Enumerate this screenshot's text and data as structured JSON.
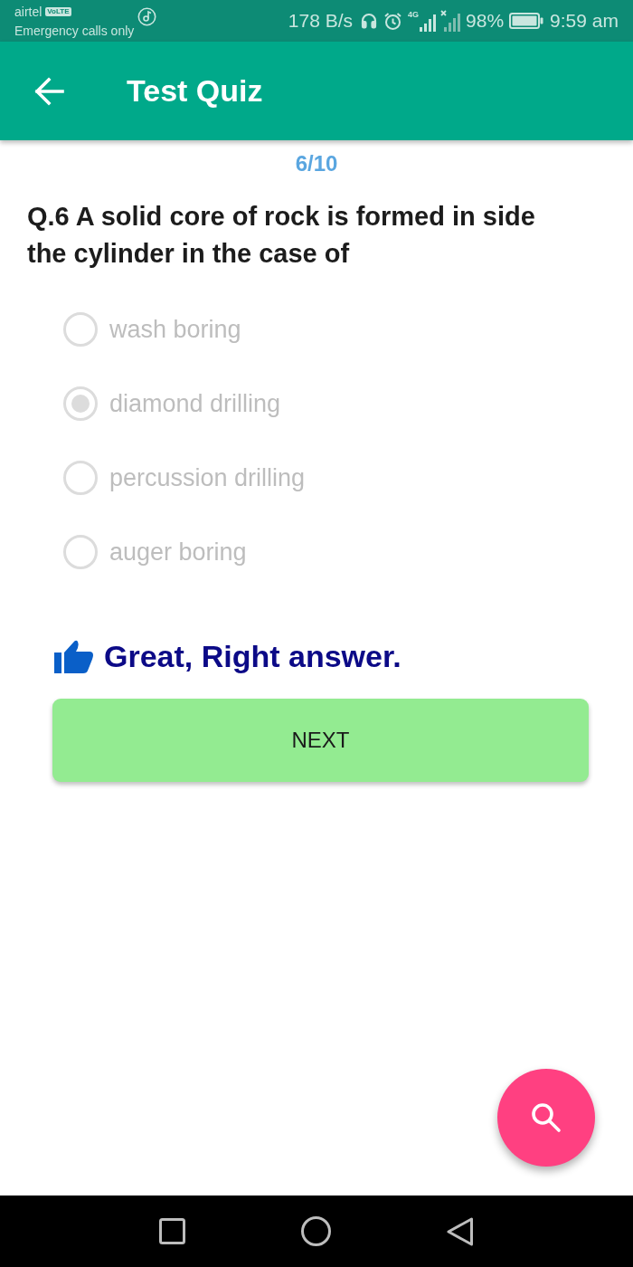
{
  "status_bar": {
    "carrier": "airtel",
    "carrier_badge": "VoLTE",
    "network_note": "Emergency calls only",
    "speed": "178 B/s",
    "network_type": "4G",
    "battery": "98%",
    "time": "9:59 am"
  },
  "app_bar": {
    "title": "Test Quiz"
  },
  "progress": "6/10",
  "question": "Q.6 A solid core of rock is formed in side the cylinder in the case of",
  "options": [
    {
      "label": "wash boring",
      "selected": false,
      "disabled": true
    },
    {
      "label": "diamond drilling",
      "selected": true,
      "disabled": true
    },
    {
      "label": "percussion drilling",
      "selected": false,
      "disabled": true
    },
    {
      "label": "auger boring",
      "selected": false,
      "disabled": true
    }
  ],
  "feedback": {
    "text": "Great, Right answer."
  },
  "next_button": {
    "label": "NEXT"
  }
}
